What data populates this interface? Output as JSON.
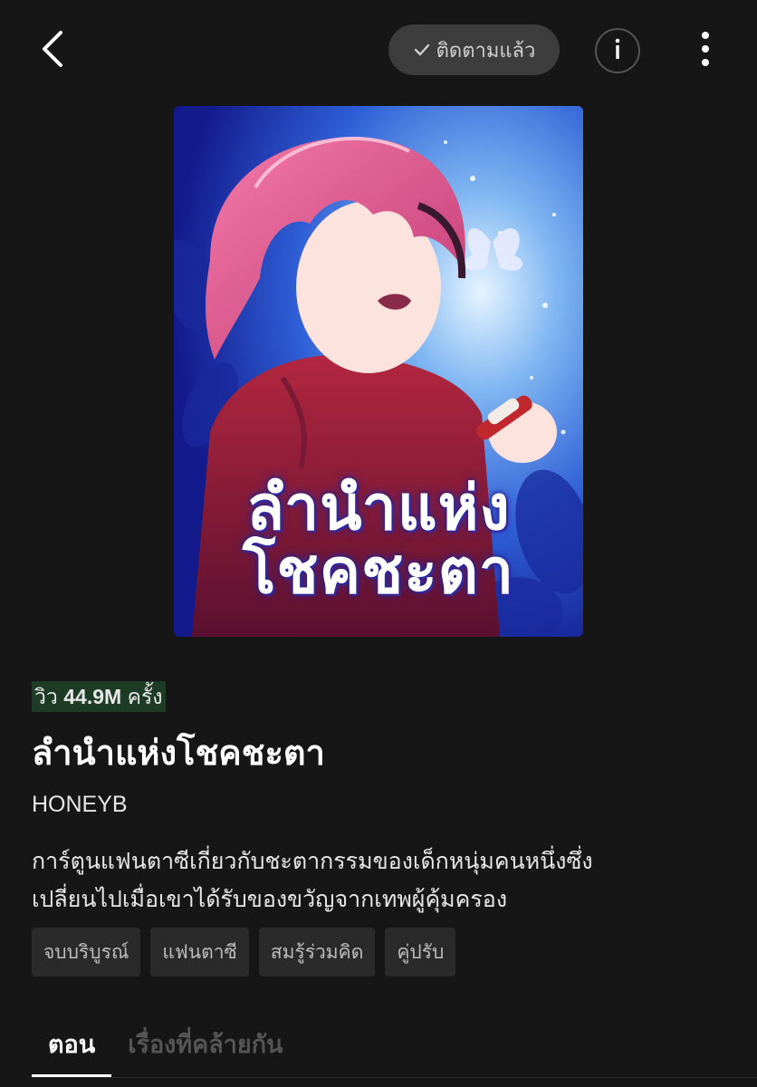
{
  "header": {
    "follow_label": "ติดตามแล้ว",
    "icons": {
      "back": "back-arrow-icon",
      "follow_check": "check-icon",
      "info": "info-icon",
      "more": "more-vertical-icon"
    }
  },
  "cover": {
    "title_line1": "ลำนำแห่ง",
    "title_line2": "โชคชะตา"
  },
  "views": {
    "prefix": "วิว",
    "count": "44.9M",
    "suffix": "ครั้ง"
  },
  "title": "ลำนำแห่งโชคชะตา",
  "author": "HONEYB",
  "description": {
    "line1": "การ์ตูนแฟนตาซีเกี่ยวกับชะตากรรมของเด็กหนุ่มคนหนึ่งซึ่ง",
    "line2": "เปลี่ยนไปเมื่อเขาได้รับของขวัญจากเทพผู้คุ้มครอง"
  },
  "tags": [
    "จบบริบูรณ์",
    "แฟนตาซี",
    "สมรู้ร่วมคิด",
    "คู่ปรับ"
  ],
  "tabs": [
    {
      "label": "ตอน",
      "active": true
    },
    {
      "label": "เรื่องที่คล้ายกัน",
      "active": false
    }
  ],
  "colors": {
    "background": "#161616",
    "views_highlight": "#1e3b26",
    "follow_button": "#3d3d3d",
    "tag_bg": "#2a2a2a"
  }
}
